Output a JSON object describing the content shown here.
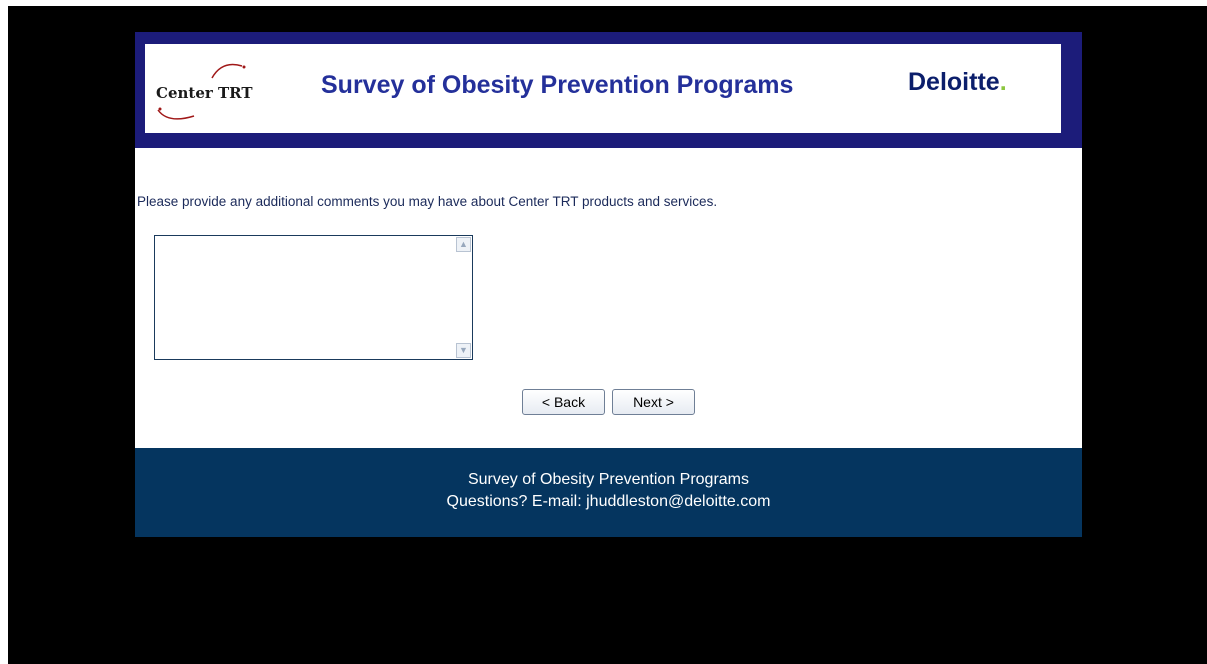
{
  "header": {
    "logo_text": "Center TRT",
    "title": "Survey of Obesity Prevention Programs",
    "brand_name": "Deloitte",
    "brand_dot": ".",
    "colors": {
      "banner_border": "#1c1c7a",
      "title": "#24309a",
      "brand_dot": "#8cc63f"
    }
  },
  "question": {
    "prompt": "Please provide any additional comments you may have about Center TRT products and services.",
    "comment_value": ""
  },
  "buttons": {
    "back_label": "< Back",
    "next_label": "Next >"
  },
  "footer": {
    "line1": "Survey of Obesity Prevention Programs",
    "line2": "Questions? E-mail: jhuddleston@deloitte.com",
    "background": "#05355f"
  },
  "icons": {
    "scroll_up": "scroll-up-icon",
    "scroll_down": "scroll-down-icon",
    "logo": "center-trt-logo"
  }
}
